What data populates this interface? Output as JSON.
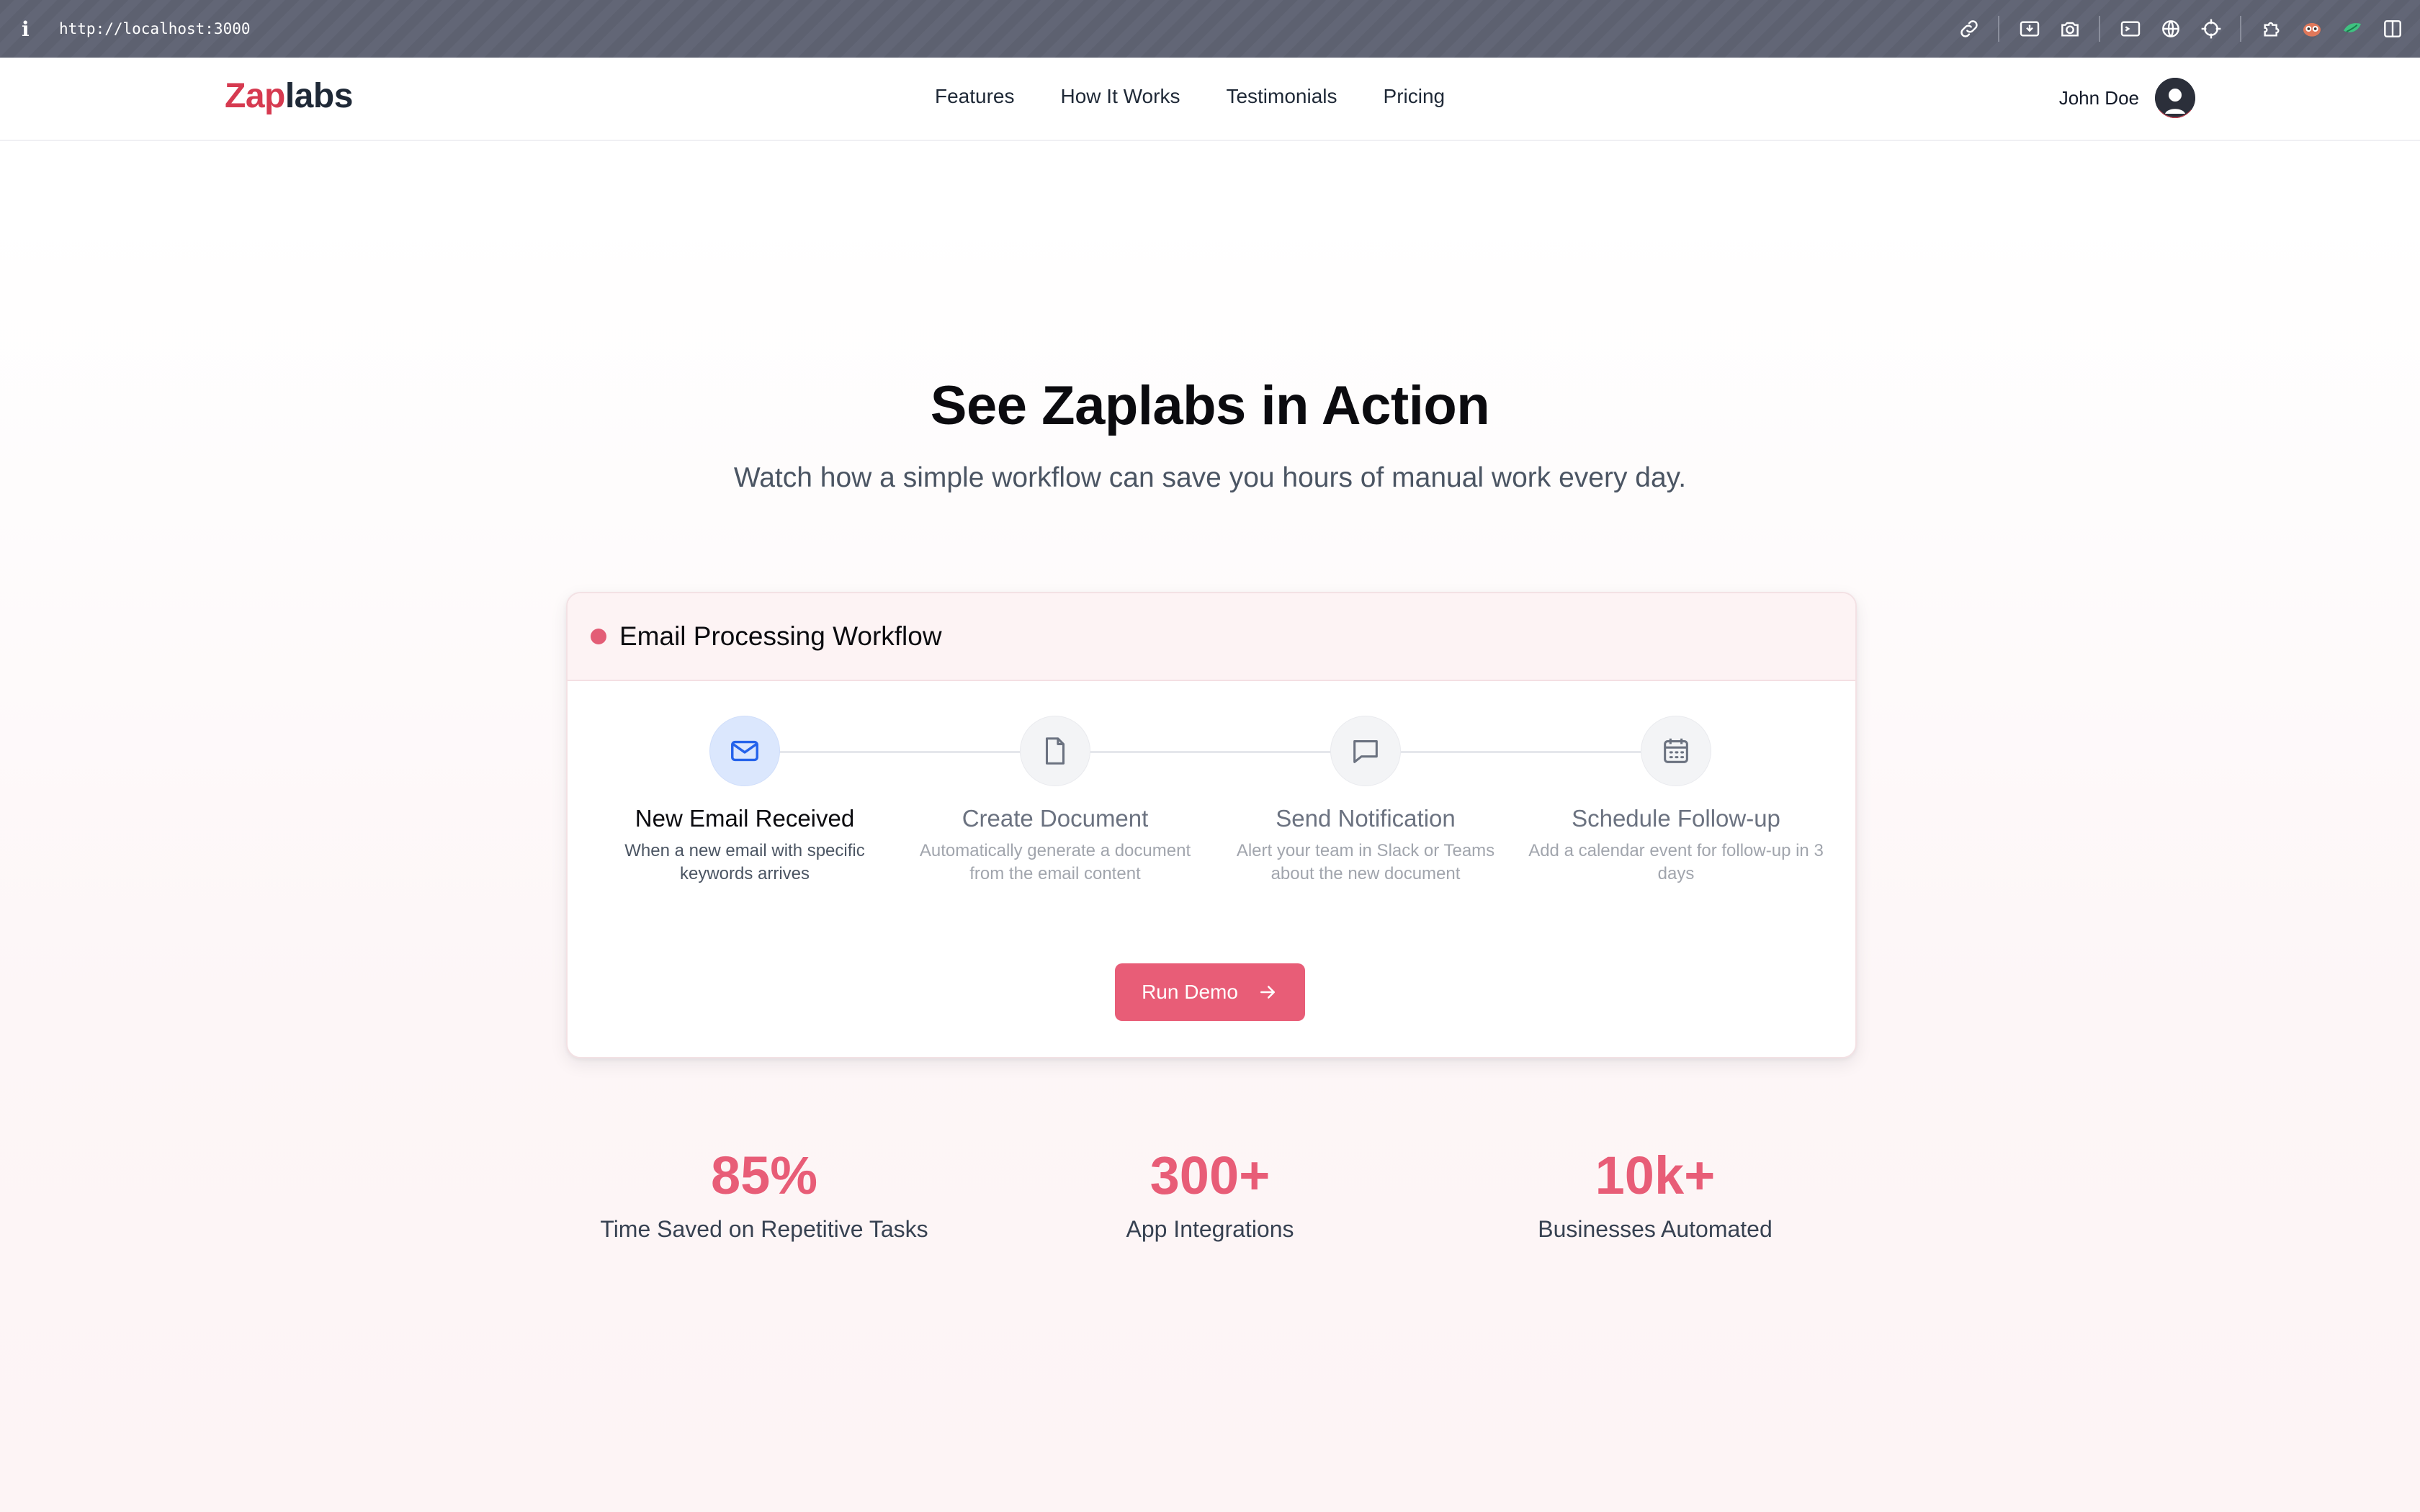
{
  "browser": {
    "info_icon": "i",
    "url": "http://localhost:3000",
    "tools": [
      "link-icon",
      "download-icon",
      "camera-icon",
      "terminal-icon",
      "globe-icon",
      "crosshair-icon",
      "puzzle-icon",
      "owl-extension-icon",
      "leaf-extension-icon",
      "sidebar-icon"
    ]
  },
  "nav": {
    "logo_part1": "Zap",
    "logo_part2": "labs",
    "links": [
      "Features",
      "How It Works",
      "Testimonials",
      "Pricing"
    ],
    "user_name": "John Doe"
  },
  "hero": {
    "title": "See Zaplabs in Action",
    "subtitle": "Watch how a simple workflow can save you hours of manual work every day."
  },
  "workflow": {
    "title": "Email Processing Workflow",
    "status_color": "#e35d76",
    "steps": [
      {
        "title": "New Email Received",
        "desc": "When a new email with specific keywords arrives",
        "icon": "mail-icon",
        "active": true
      },
      {
        "title": "Create Document",
        "desc": "Automatically generate a document from the email content",
        "icon": "document-icon",
        "active": false
      },
      {
        "title": "Send Notification",
        "desc": "Alert your team in Slack or Teams about the new document",
        "icon": "chat-icon",
        "active": false
      },
      {
        "title": "Schedule Follow-up",
        "desc": "Add a calendar event for follow-up in 3 days",
        "icon": "calendar-icon",
        "active": false
      }
    ],
    "run_button": "Run Demo"
  },
  "stats": [
    {
      "value": "85%",
      "label": "Time Saved on Repetitive Tasks"
    },
    {
      "value": "300+",
      "label": "App Integrations"
    },
    {
      "value": "10k+",
      "label": "Businesses Automated"
    }
  ],
  "colors": {
    "brand": "#d63a50",
    "accent": "#e85d77",
    "active_step_bg": "#dbe7fd",
    "active_icon": "#2563eb"
  }
}
